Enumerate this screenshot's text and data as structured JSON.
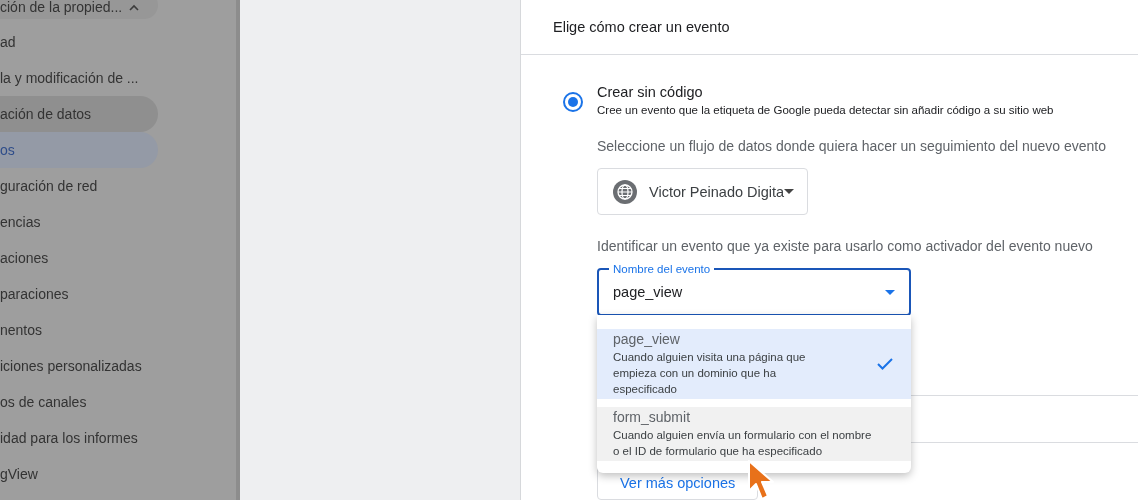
{
  "sidebar": {
    "items": [
      {
        "label": "ción de la propied...",
        "kind": "group",
        "expanded": true,
        "selected": false,
        "hovered": false
      },
      {
        "label": "ad",
        "kind": "item",
        "selected": false,
        "hovered": false
      },
      {
        "label": "la y modificación de ...",
        "kind": "item",
        "selected": false,
        "hovered": false
      },
      {
        "label": "ación de datos",
        "kind": "item",
        "selected": false,
        "hovered": true
      },
      {
        "label": "os",
        "kind": "item",
        "selected": true,
        "hovered": false
      },
      {
        "label": "guración de red",
        "kind": "item",
        "selected": false,
        "hovered": false
      },
      {
        "label": "encias",
        "kind": "item",
        "selected": false,
        "hovered": false
      },
      {
        "label": "aciones",
        "kind": "item",
        "selected": false,
        "hovered": false
      },
      {
        "label": "paraciones",
        "kind": "item",
        "selected": false,
        "hovered": false
      },
      {
        "label": "nentos",
        "kind": "item",
        "selected": false,
        "hovered": false
      },
      {
        "label": "iciones personalizadas",
        "kind": "item",
        "selected": false,
        "hovered": false
      },
      {
        "label": "os de canales",
        "kind": "item",
        "selected": false,
        "hovered": false
      },
      {
        "label": "idad para los informes",
        "kind": "item",
        "selected": false,
        "hovered": false
      },
      {
        "label": "gView",
        "kind": "item",
        "selected": false,
        "hovered": false
      }
    ]
  },
  "dialog": {
    "title": "Elige cómo crear un evento",
    "option": {
      "title": "Crear sin código",
      "description": "Cree un evento que la etiqueta de Google pueda detectar sin añadir código a su sitio web",
      "selected": true
    },
    "stream_label": "Seleccione un flujo de datos donde quiera hacer un seguimiento del nuevo evento",
    "stream_select": {
      "value": "Victor Peinado Digita"
    },
    "event_label": "Identificar un evento que ya existe para usarlo como activador del evento nuevo",
    "event_field": {
      "label": "Nombre del evento",
      "value": "page_view"
    },
    "event_menu": [
      {
        "name": "page_view",
        "description": "Cuando alguien visita una página que empieza con un dominio que ha especificado",
        "selected": true,
        "hovered": false
      },
      {
        "name": "form_submit",
        "description": "Cuando alguien envía un formulario con el nombre o el ID de formulario que ha especificado",
        "selected": false,
        "hovered": true
      }
    ],
    "more_button": "Ver más opciones"
  }
}
